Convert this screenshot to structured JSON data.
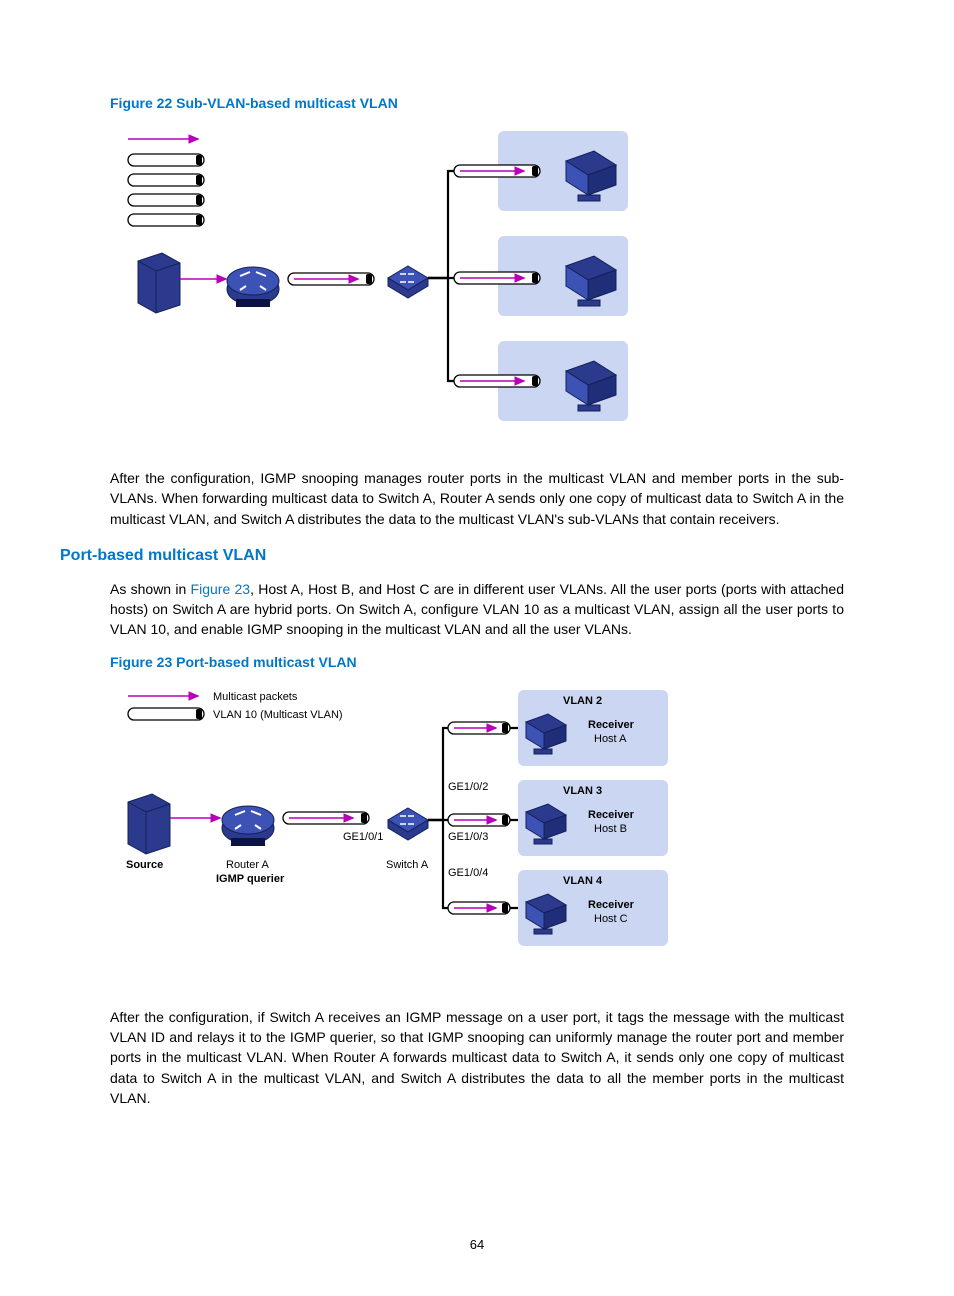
{
  "figure22": {
    "caption": "Figure 22 Sub-VLAN-based multicast VLAN"
  },
  "paragraph1": "After the configuration, IGMP snooping manages router ports in the multicast VLAN and member ports in the sub-VLANs. When forwarding multicast data to Switch A, Router A sends only one copy of multicast data to Switch A in the multicast VLAN, and Switch A distributes the data to the multicast VLAN's sub-VLANs that contain receivers.",
  "section_heading": "Port-based multicast VLAN",
  "paragraph2_a": "As shown in ",
  "paragraph2_link": "Figure 23",
  "paragraph2_b": ", Host A, Host B, and Host C are in different user VLANs. All the user ports (ports with attached hosts) on Switch A are hybrid ports. On Switch A, configure VLAN 10 as a multicast VLAN, assign all the user ports to VLAN 10, and enable IGMP snooping in the multicast VLAN and all the user VLANs.",
  "figure23": {
    "caption": "Figure 23 Port-based multicast VLAN",
    "legend_multicast": "Multicast packets",
    "legend_vlan10": "VLAN 10 (Multicast VLAN)",
    "vlan2": "VLAN 2",
    "vlan3": "VLAN 3",
    "vlan4": "VLAN 4",
    "receiver": "Receiver",
    "hostA": "Host A",
    "hostB": "Host B",
    "hostC": "Host C",
    "source": "Source",
    "routerA": "Router A",
    "switchA": "Switch A",
    "igmp_querier": "IGMP querier",
    "ge1_0_1": "GE1/0/1",
    "ge1_0_2": "GE1/0/2",
    "ge1_0_3": "GE1/0/3",
    "ge1_0_4": "GE1/0/4"
  },
  "paragraph3": "After the configuration, if Switch A receives an IGMP message on a user port, it tags the message with the multicast VLAN ID and relays it to the IGMP querier, so that IGMP snooping can uniformly manage the router port and member ports in the multicast VLAN. When Router A forwards multicast data to Switch A, it sends only one copy of multicast data to Switch A in the multicast VLAN, and Switch A distributes the data to all the member ports in the multicast VLAN.",
  "page_number": "64"
}
